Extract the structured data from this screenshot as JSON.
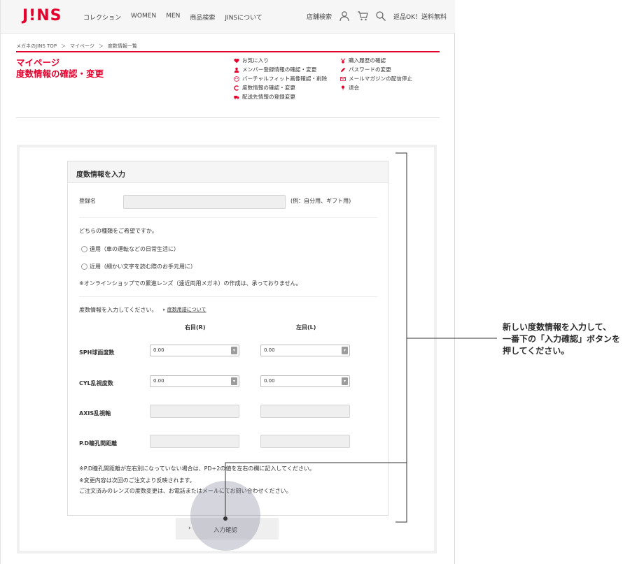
{
  "header": {
    "logo": "J!NS",
    "nav": [
      "コレクション",
      "WOMEN",
      "MEN",
      "商品検索",
      "JINSについて"
    ],
    "store_search": "店舗検索",
    "shipping_note": "返品OK！送料無料"
  },
  "breadcrumb": [
    "メガネのJINS TOP",
    "＞",
    "マイページ",
    "＞",
    "度数情報一覧"
  ],
  "page_title": [
    "マイページ",
    "度数情報の確認・変更"
  ],
  "mypage_menu": {
    "col1": [
      {
        "icon": "heart-icon",
        "label": "お気に入り"
      },
      {
        "icon": "user-icon",
        "label": "メンバー登録情報の確認・変更"
      },
      {
        "icon": "face-icon",
        "label": "バーチャルフィット画像確認・削除"
      },
      {
        "icon": "c-icon",
        "label": "度数情報の確認・変更"
      },
      {
        "icon": "truck-icon",
        "label": "配送先情報の登録変更"
      }
    ],
    "col2": [
      {
        "icon": "yen-icon",
        "label": "購入履歴の確認"
      },
      {
        "icon": "pencil-icon",
        "label": "パスワードの変更"
      },
      {
        "icon": "mail-icon",
        "label": "メールマガジンの配信停止"
      },
      {
        "icon": "pin-icon",
        "label": "退会"
      }
    ]
  },
  "form": {
    "heading": "度数情報を入力",
    "registration_label": "登録名",
    "registration_hint": "(例：自分用、ギフト用)",
    "type_question": "どちらの種類をご希望ですか。",
    "type_options": [
      "遠用（車の運転などの日常生活に）",
      "近用（細かい文字を読む際のお手元用に）"
    ],
    "type_note": "※オンラインショップでの累進レンズ（遠近両用メガネ）の作成は、承っておりません。",
    "power_prompt": "度数情報を入力してください。",
    "glossary_link": "度数用語について",
    "right_eye": "右目(R)",
    "left_eye": "左目(L)",
    "rows": [
      {
        "label": "SPH球面度数",
        "right": "0.00",
        "left": "0.00"
      },
      {
        "label": "CYL乱視度数",
        "right": "0.00",
        "left": "0.00"
      },
      {
        "label": "AXIS乱視軸",
        "right": "",
        "left": ""
      },
      {
        "label": "P.D瞳孔間距離",
        "right": "",
        "left": ""
      }
    ],
    "notes": [
      "※P.D瞳孔間距離が左右別になっていない場合は、PD÷2の値を左右の欄に記入してください。",
      "※変更内容は次回のご注文より反映されます。",
      "ご注文済みのレンズの度数変更は、お電話またはメールにてお問い合わせください。"
    ],
    "submit_label": "入力確認"
  },
  "annotation": [
    "新しい度数情報を入力して、",
    "一番下の「入力確認」ボタンを",
    "押してください。"
  ],
  "colors": {
    "brand": "#e5002d",
    "highlight": "#787d96"
  }
}
